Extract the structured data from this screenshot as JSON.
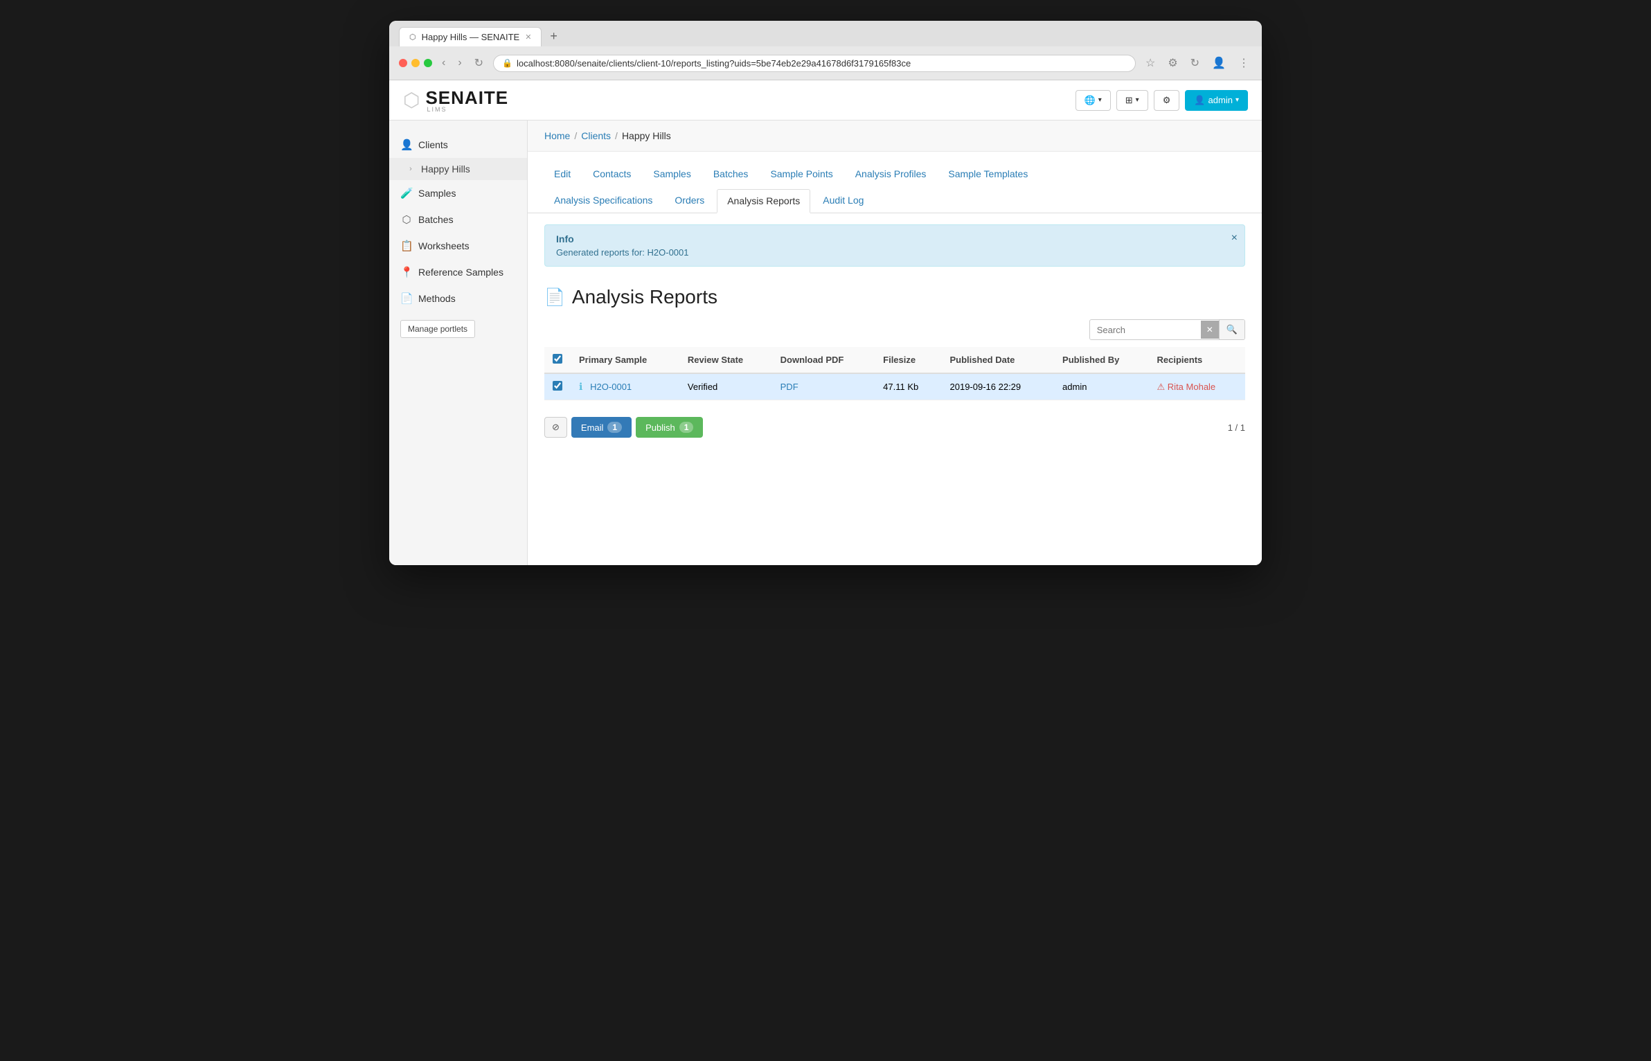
{
  "browser": {
    "url": "localhost:8080/senaite/clients/client-10/reports_listing?uids=5be74eb2e29a41678d6f3179165f83ce",
    "tab_title": "Happy Hills — SENAITE",
    "tab_favicon": "⬡"
  },
  "topnav": {
    "logo_text": "SENAITE",
    "logo_lims": "LIMS",
    "globe_btn": "🌐",
    "grid_btn": "⊞",
    "settings_btn": "⚙",
    "user_btn": "👤 admin ▾"
  },
  "sidebar": {
    "items": [
      {
        "id": "clients",
        "icon": "👤",
        "label": "Clients"
      },
      {
        "id": "happy-hills",
        "icon": "›",
        "label": "Happy Hills",
        "is_child": true
      },
      {
        "id": "samples",
        "icon": "🧪",
        "label": "Samples"
      },
      {
        "id": "batches",
        "icon": "⬡",
        "label": "Batches"
      },
      {
        "id": "worksheets",
        "icon": "📋",
        "label": "Worksheets"
      },
      {
        "id": "reference-samples",
        "icon": "📍",
        "label": "Reference Samples"
      },
      {
        "id": "methods",
        "icon": "📄",
        "label": "Methods"
      }
    ],
    "manage_portlets": "Manage portlets"
  },
  "breadcrumb": {
    "home": "Home",
    "clients": "Clients",
    "current": "Happy Hills"
  },
  "tabs": {
    "row1": [
      {
        "id": "edit",
        "label": "Edit",
        "active": false
      },
      {
        "id": "contacts",
        "label": "Contacts",
        "active": false
      },
      {
        "id": "samples",
        "label": "Samples",
        "active": false
      },
      {
        "id": "batches",
        "label": "Batches",
        "active": false
      },
      {
        "id": "sample-points",
        "label": "Sample Points",
        "active": false
      },
      {
        "id": "analysis-profiles",
        "label": "Analysis Profiles",
        "active": false
      },
      {
        "id": "sample-templates",
        "label": "Sample Templates",
        "active": false
      }
    ],
    "row2": [
      {
        "id": "analysis-specifications",
        "label": "Analysis Specifications",
        "active": false
      },
      {
        "id": "orders",
        "label": "Orders",
        "active": false
      },
      {
        "id": "analysis-reports",
        "label": "Analysis Reports",
        "active": true
      },
      {
        "id": "audit-log",
        "label": "Audit Log",
        "active": false
      }
    ]
  },
  "info_box": {
    "title": "Info",
    "message": "Generated reports for: H2O-0001"
  },
  "page_title": "Analysis Reports",
  "search": {
    "placeholder": "Search",
    "label": "Search"
  },
  "table": {
    "headers": [
      {
        "id": "checkbox",
        "label": ""
      },
      {
        "id": "primary-sample",
        "label": "Primary Sample"
      },
      {
        "id": "review-state",
        "label": "Review State"
      },
      {
        "id": "download-pdf",
        "label": "Download PDF"
      },
      {
        "id": "filesize",
        "label": "Filesize"
      },
      {
        "id": "published-date",
        "label": "Published Date"
      },
      {
        "id": "published-by",
        "label": "Published By"
      },
      {
        "id": "recipients",
        "label": "Recipients"
      }
    ],
    "rows": [
      {
        "checked": true,
        "has_info": true,
        "sample_id": "H2O-0001",
        "review_state": "Verified",
        "download_pdf": "PDF",
        "filesize": "47.11 Kb",
        "published_date": "2019-09-16 22:29",
        "published_by": "admin",
        "recipients": "Rita Mohale",
        "recipient_warning": true
      }
    ]
  },
  "actions": {
    "discard_icon": "⊘",
    "email_label": "Email",
    "email_count": "1",
    "publish_label": "Publish",
    "publish_count": "1"
  },
  "pagination": {
    "current": "1 / 1"
  }
}
